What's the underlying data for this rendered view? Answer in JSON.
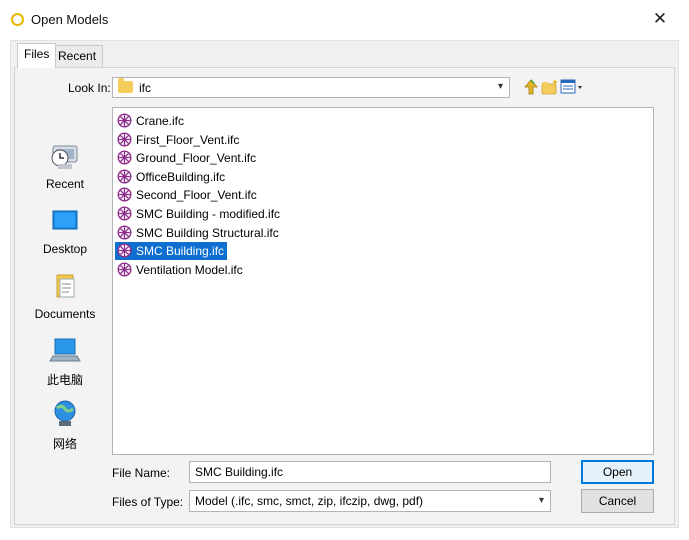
{
  "window": {
    "title": "Open Models",
    "close_glyph": "✕"
  },
  "tabs": [
    {
      "label": "Files",
      "active": true
    },
    {
      "label": "Recent",
      "active": false
    }
  ],
  "look_in": {
    "label": "Look In:",
    "value": "ifc"
  },
  "places": [
    {
      "label": "Recent",
      "icon": "recent-places-icon"
    },
    {
      "label": "Desktop",
      "icon": "desktop-icon"
    },
    {
      "label": "Documents",
      "icon": "documents-icon"
    },
    {
      "label": "此电脑",
      "icon": "this-pc-icon"
    },
    {
      "label": "网络",
      "icon": "network-icon"
    }
  ],
  "files": [
    {
      "name": "Crane.ifc",
      "selected": false
    },
    {
      "name": "First_Floor_Vent.ifc",
      "selected": false
    },
    {
      "name": "Ground_Floor_Vent.ifc",
      "selected": false
    },
    {
      "name": "OfficeBuilding.ifc",
      "selected": false
    },
    {
      "name": "Second_Floor_Vent.ifc",
      "selected": false
    },
    {
      "name": "SMC Building - modified.ifc",
      "selected": false
    },
    {
      "name": "SMC Building Structural.ifc",
      "selected": false
    },
    {
      "name": "SMC Building.ifc",
      "selected": true
    },
    {
      "name": "Ventilation Model.ifc",
      "selected": false
    }
  ],
  "file_name": {
    "label": "File Name:",
    "value": "SMC Building.ifc"
  },
  "files_of_type": {
    "label": "Files of Type:",
    "value": "Model (.ifc, smc, smct, zip, ifczip, dwg, pdf)"
  },
  "buttons": {
    "open": "Open",
    "cancel": "Cancel"
  },
  "colors": {
    "selection": "#0f6fd0",
    "default_button_border": "#0078d7",
    "ifc_icon": "#8e2e8c"
  }
}
